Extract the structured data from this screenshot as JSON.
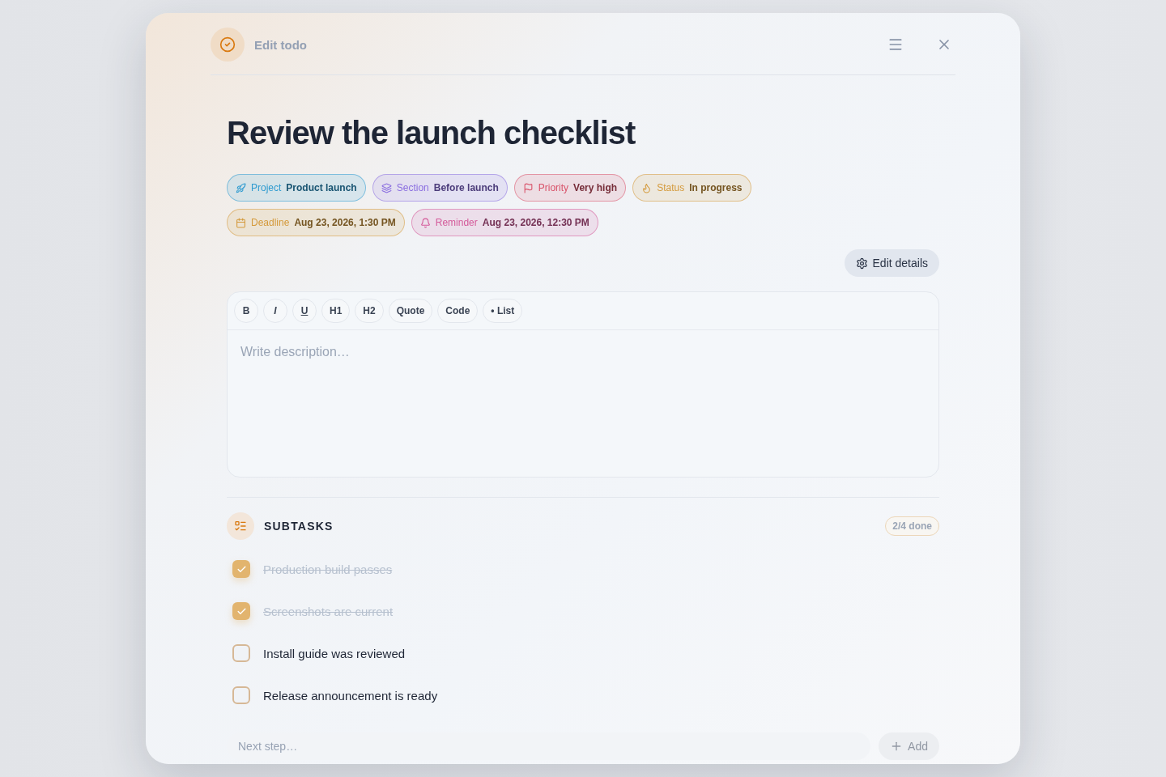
{
  "dialog": {
    "title": "Edit todo"
  },
  "todo": {
    "title": "Review the launch checklist"
  },
  "chips": [
    {
      "kind": "project",
      "label": "Project",
      "value": "Product launch",
      "color": "#2f9bd0"
    },
    {
      "kind": "section",
      "label": "Section",
      "value": "Before launch",
      "color": "#8b6fe0"
    },
    {
      "kind": "priority",
      "label": "Priority",
      "value": "Very high",
      "color": "#d9536a"
    },
    {
      "kind": "status",
      "label": "Status",
      "value": "In progress",
      "color": "#d49a3c"
    },
    {
      "kind": "deadline",
      "label": "Deadline",
      "value": "Aug 23, 2026, 1:30 PM",
      "color": "#d49a3c"
    },
    {
      "kind": "reminder",
      "label": "Reminder",
      "value": "Aug 23, 2026, 12:30 PM",
      "color": "#d45a9a"
    }
  ],
  "edit_details_button": "Edit details",
  "editor": {
    "toolbar": [
      {
        "kind": "bold",
        "label": "B"
      },
      {
        "kind": "italic",
        "label": "I"
      },
      {
        "kind": "underline",
        "label": "U"
      },
      {
        "kind": "plain",
        "label": "H1"
      },
      {
        "kind": "plain",
        "label": "H2"
      },
      {
        "kind": "plain",
        "label": "Quote"
      },
      {
        "kind": "plain",
        "label": "Code"
      },
      {
        "kind": "plain",
        "label": "• List"
      }
    ],
    "placeholder": "Write description…"
  },
  "subtasks": {
    "title": "SUBTASKS",
    "progress": "2/4 done",
    "items": [
      {
        "label": "Production build passes",
        "checked": true
      },
      {
        "label": "Screenshots are current",
        "checked": true
      },
      {
        "label": "Install guide was reviewed",
        "checked": false
      },
      {
        "label": "Release announcement is ready",
        "checked": false
      }
    ],
    "new_placeholder": "Next step…",
    "add_button": "Add"
  }
}
